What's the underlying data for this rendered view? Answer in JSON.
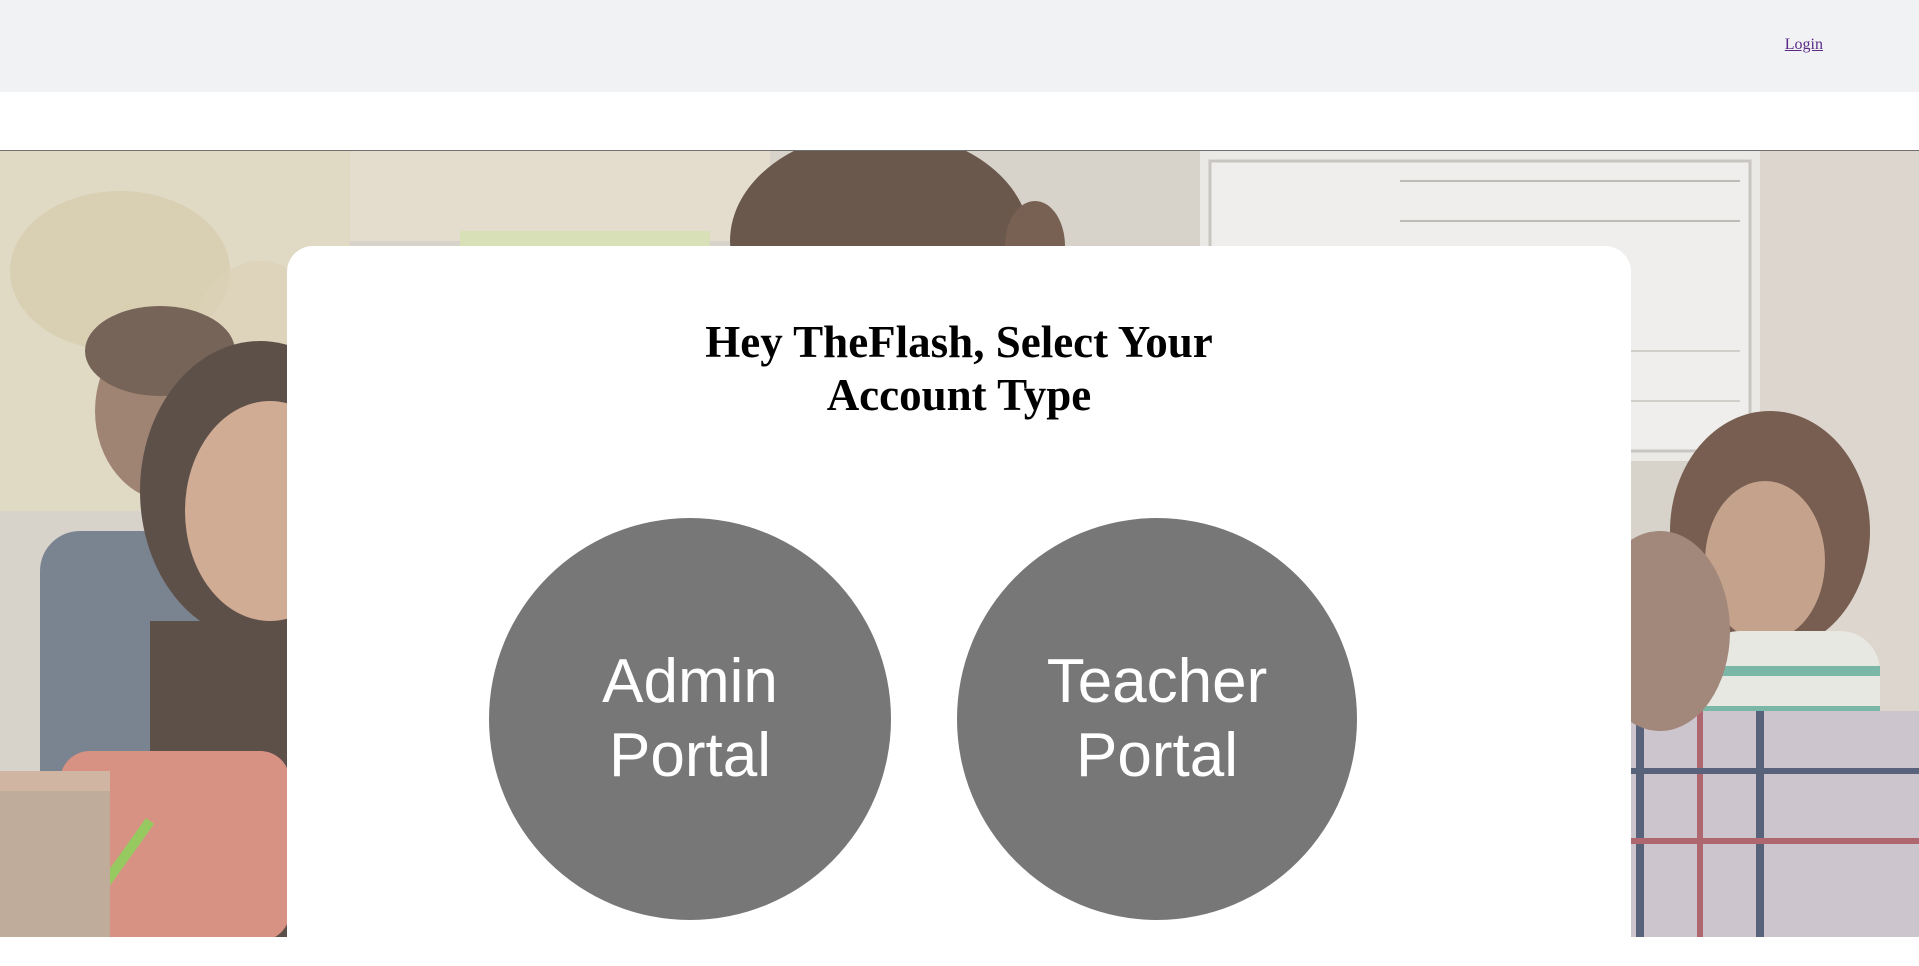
{
  "header": {
    "login_label": "Login"
  },
  "card": {
    "title_line1": "Hey TheFlash, Select Your",
    "title_line2": "Account Type"
  },
  "portals": [
    {
      "line1": "Admin",
      "line2": "Portal"
    },
    {
      "line1": "Teacher",
      "line2": "Portal"
    }
  ],
  "colors": {
    "topbar": "#f1f2f4",
    "portal_circle": "#777777",
    "link": "#5a2a87"
  }
}
